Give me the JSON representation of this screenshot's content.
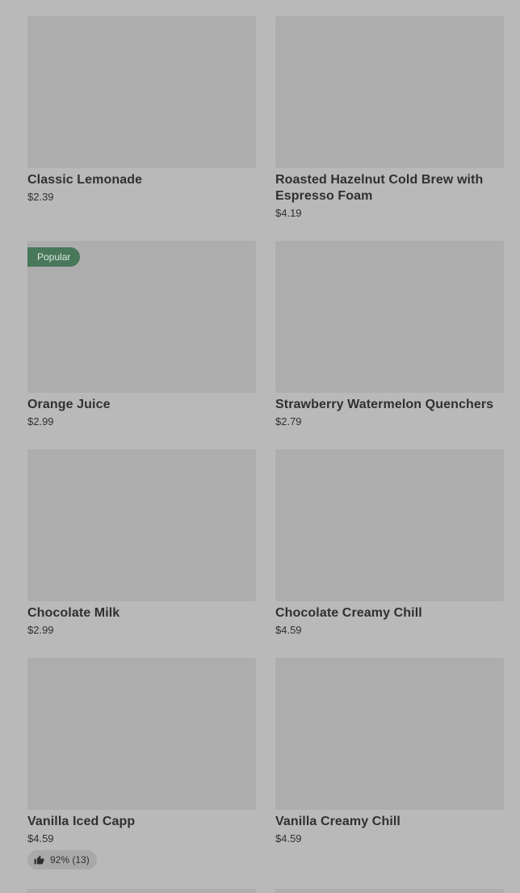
{
  "products": [
    {
      "name": "Classic Lemonade",
      "price": "$2.39"
    },
    {
      "name": "Roasted Hazelnut Cold Brew with Espresso Foam",
      "price": "$4.19"
    },
    {
      "name": "Orange Juice",
      "price": "$2.99",
      "badge": "Popular"
    },
    {
      "name": "Strawberry Watermelon Quenchers",
      "price": "$2.79"
    },
    {
      "name": "Chocolate Milk",
      "price": "$2.99"
    },
    {
      "name": "Chocolate Creamy Chill",
      "price": "$4.59"
    },
    {
      "name": "Vanilla Iced Capp",
      "price": "$4.59",
      "rating": "92% (13)"
    },
    {
      "name": "Vanilla Creamy Chill",
      "price": "$4.59"
    }
  ],
  "colors": {
    "overlay_background": "#b9b9b9",
    "image_placeholder": "#adadad",
    "badge_background": "#48775a",
    "text": "#303030"
  },
  "icons": {
    "rating": "thumbs-up-icon"
  }
}
